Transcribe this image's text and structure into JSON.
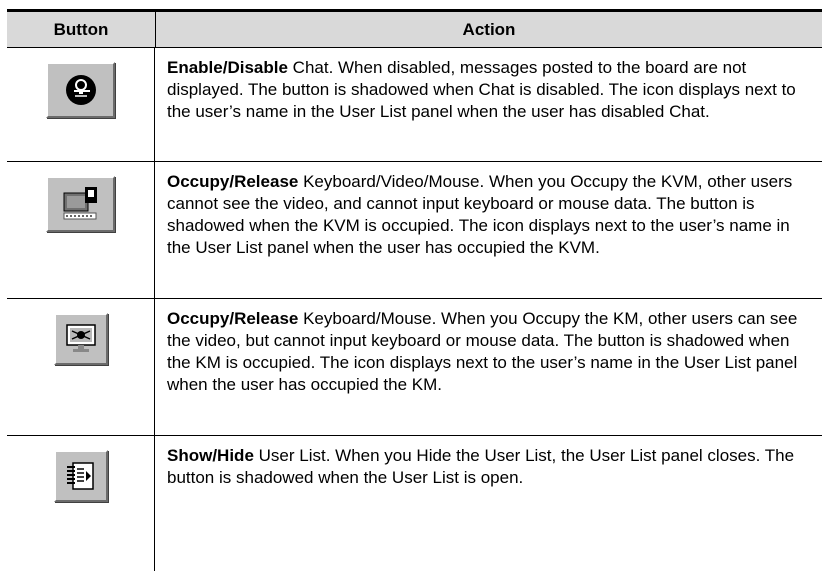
{
  "header": {
    "button": "Button",
    "action": "Action"
  },
  "rows": [
    {
      "icon": "chat-icon",
      "bold": "Enable/Disable",
      "text": " Chat. When disabled, messages posted to the board are not displayed. The button is shadowed when Chat is disabled. The icon displays next to the user’s name in the User List panel when the user has disabled Chat."
    },
    {
      "icon": "kvm-occupy-icon",
      "bold": "Occupy/Release",
      "text": " Keyboard/Video/Mouse. When you Occupy the KVM, other users cannot see the video, and cannot input keyboard or mouse data. The button is shadowed when the KVM is occupied. The icon displays next to the user’s name in the User List panel when the user has occupied the KVM."
    },
    {
      "icon": "km-occupy-icon",
      "bold": "Occupy/Release",
      "text": " Keyboard/Mouse. When you Occupy the KM, other users can see the video, but cannot input keyboard or mouse data. The button is shadowed when the KM is occupied. The icon displays next to the user’s name in the User List panel when the user has occupied the KM."
    },
    {
      "icon": "user-list-icon",
      "bold": "Show/Hide",
      "text": " User List. When you Hide the User List, the User List panel closes. The button is shadowed when the User List is open."
    }
  ]
}
